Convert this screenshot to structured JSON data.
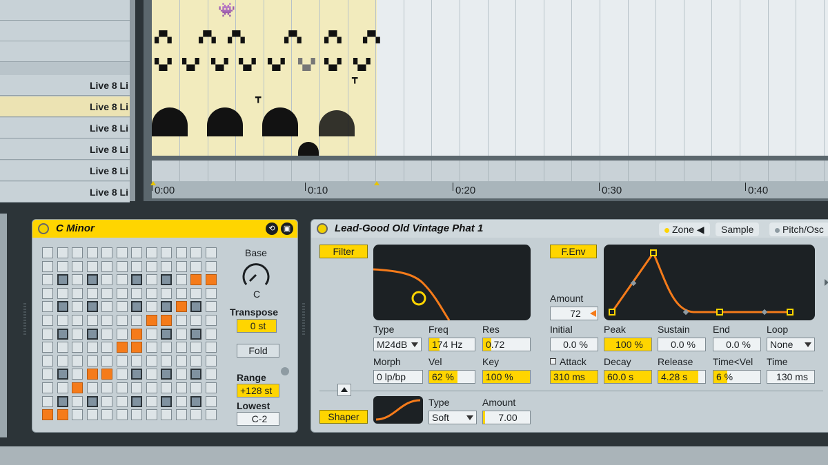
{
  "tracks": [
    {
      "label": ""
    },
    {
      "label": ""
    },
    {
      "label": ""
    },
    {
      "label": "Live 8 Li"
    },
    {
      "label": "Live 8 Li",
      "selected": true
    },
    {
      "label": "Live 8 Li"
    },
    {
      "label": "Live 8 Li"
    },
    {
      "label": "Live 8 Li"
    },
    {
      "label": "Live 8 Li"
    }
  ],
  "timeline": {
    "labels": [
      "0:00",
      "0:10",
      "0:20",
      "0:30",
      "0:40"
    ]
  },
  "scale": {
    "title": "C Minor",
    "base_label": "Base",
    "base_value": "C",
    "transpose_label": "Transpose",
    "transpose_value": "0 st",
    "fold_label": "Fold",
    "range_label": "Range",
    "range_value": "+128 st",
    "lowest_label": "Lowest",
    "lowest_value": "C-2"
  },
  "sampler": {
    "title": "Lead-Good Old Vintage Phat 1",
    "tabs": {
      "zone": "Zone",
      "sample": "Sample",
      "pitch": "Pitch/Osc"
    },
    "filter_button": "Filter",
    "type_label": "Type",
    "type_value": "M24dB",
    "freq_label": "Freq",
    "freq_value": "174 Hz",
    "res_label": "Res",
    "res_value": "0.72",
    "morph_label": "Morph",
    "morph_value": "0 lp/bp",
    "vel_label": "Vel",
    "vel_value": "62 %",
    "key_label": "Key",
    "key_value": "100 %",
    "fenv_button": "F.Env",
    "amount_label": "Amount",
    "amount_value": "72",
    "initial_label": "Initial",
    "initial_value": "0.0 %",
    "peak_label": "Peak",
    "peak_value": "100 %",
    "sustain_label": "Sustain",
    "sustain_value": "0.0 %",
    "end_label": "End",
    "end_value": "0.0 %",
    "loop_label": "Loop",
    "loop_value": "None",
    "attack_label": "Attack",
    "attack_value": "310 ms",
    "decay_label": "Decay",
    "decay_value": "60.0 s",
    "release_label": "Release",
    "release_value": "4.28 s",
    "timevel_label": "Time<Vel",
    "timevel_value": "6 %",
    "time_label": "Time",
    "time_value": "130 ms",
    "shaper_button": "Shaper",
    "shaper_type_label": "Type",
    "shaper_type_value": "Soft",
    "shaper_amount_label": "Amount",
    "shaper_amount_value": "7.00"
  },
  "colors": {
    "accent": "#ffd500",
    "orange": "#f57b1a",
    "panel": "#c5cfd4"
  }
}
